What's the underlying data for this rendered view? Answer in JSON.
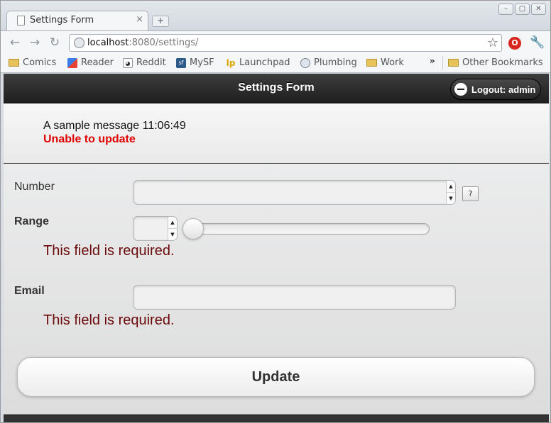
{
  "browser": {
    "tab_title": "Settings Form",
    "tab_close": "×",
    "url_host": "localhost",
    "url_rest": ":8080/settings/",
    "bookmarks": [
      {
        "label": "Comics",
        "icon": "folder-icon"
      },
      {
        "label": "Reader",
        "icon": "google-reader-icon"
      },
      {
        "label": "Reddit",
        "icon": "reddit-icon"
      },
      {
        "label": "MySF",
        "icon": "sf-icon"
      },
      {
        "label": "Launchpad",
        "icon": "launchpad-icon"
      },
      {
        "label": "Plumbing",
        "icon": "plumbing-icon"
      },
      {
        "label": "Work",
        "icon": "folder-icon"
      }
    ],
    "bookmarks_overflow": "»",
    "other_bookmarks": "Other Bookmarks"
  },
  "header": {
    "title": "Settings Form",
    "logout_label": "Logout: admin"
  },
  "messages": {
    "info": "A sample message 11:06:49",
    "error": "Unable to update"
  },
  "form": {
    "number": {
      "label": "Number",
      "value": "",
      "help": "?"
    },
    "range": {
      "label": "Range",
      "value": "",
      "slider_fraction": 0,
      "error": "This field is required."
    },
    "email": {
      "label": "Email",
      "value": "",
      "error": "This field is required."
    },
    "submit_label": "Update"
  },
  "colors": {
    "error_red": "#e00000",
    "field_error": "#6b0b0b",
    "header_bg": "#2a2a2a"
  }
}
